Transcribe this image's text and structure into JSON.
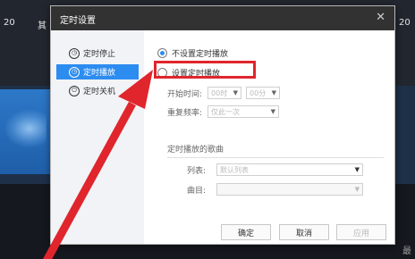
{
  "background": {
    "left_text": "20",
    "left_text2": "其",
    "right_text": "20",
    "bottom_right_text": "最"
  },
  "dialog": {
    "title": "定时设置",
    "close_glyph": "✕"
  },
  "sidebar": {
    "items": [
      {
        "label": "定时停止",
        "icon": "timer-stop-icon",
        "active": false
      },
      {
        "label": "定时播放",
        "icon": "timer-play-icon",
        "active": true
      },
      {
        "label": "定时关机",
        "icon": "power-icon",
        "active": false
      }
    ]
  },
  "options": {
    "no_timer_label": "不设置定时播放",
    "set_timer_label": "设置定时播放"
  },
  "schedule": {
    "start_time_label": "开始时间:",
    "hour_value": "00时",
    "minute_value": "00分",
    "repeat_label": "重复频率:",
    "repeat_value": "仅此一次"
  },
  "songs": {
    "section_title": "定时播放的歌曲",
    "list_label": "列表:",
    "list_value": "默认列表",
    "track_label": "曲目:",
    "track_value": ""
  },
  "buttons": {
    "ok": "确定",
    "cancel": "取消",
    "apply": "应用"
  },
  "colors": {
    "accent": "#2d8cf0",
    "annotation_red": "#e0252d"
  }
}
